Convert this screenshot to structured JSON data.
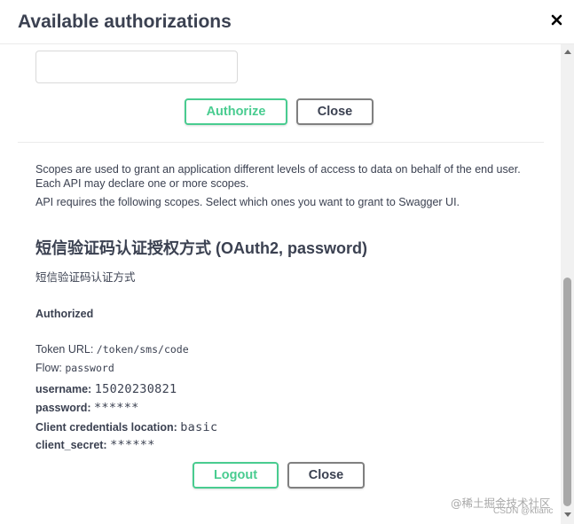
{
  "modal": {
    "title": "Available authorizations",
    "close_icon": "close-icon"
  },
  "top_form": {
    "input_value": "",
    "authorize_label": "Authorize",
    "close_label": "Close"
  },
  "scopes": {
    "description": "Scopes are used to grant an application different levels of access to data on behalf of the end user. Each API may declare one or more scopes.",
    "requirement": "API requires the following scopes. Select which ones you want to grant to Swagger UI."
  },
  "scheme": {
    "title": "短信验证码认证授权方式 (OAuth2, password)",
    "description": "短信验证码认证方式",
    "authorized_label": "Authorized",
    "token_url_label": "Token URL:",
    "token_url_value": "/token/sms/code",
    "flow_label": "Flow:",
    "flow_value": "password",
    "username_label": "username:",
    "username_value": "15020230821",
    "password_label": "password:",
    "password_value": "******",
    "client_location_label": "Client credentials location:",
    "client_location_value": "basic",
    "client_secret_label": "client_secret:",
    "client_secret_value": "******",
    "logout_label": "Logout",
    "close_label": "Close"
  },
  "watermark": {
    "line1": "@稀土掘金技术社区",
    "line2": "CSDN @ktianc"
  },
  "colors": {
    "accent": "#49cc90",
    "text": "#3b4151",
    "border_gray": "#808080"
  }
}
